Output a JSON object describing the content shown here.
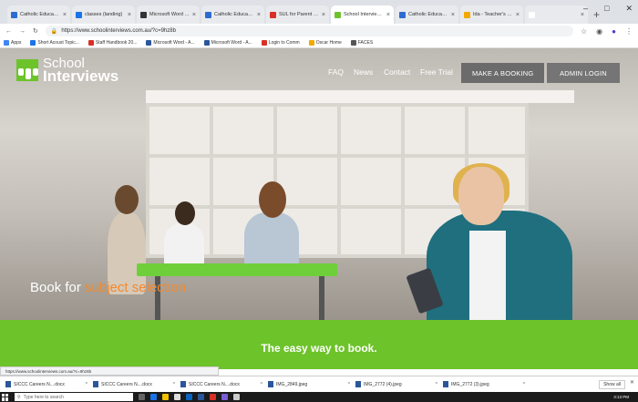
{
  "browser": {
    "tabs": [
      {
        "title": "Catholic Education",
        "color": "#2d6bd1"
      },
      {
        "title": "classes (landing)",
        "color": "#1a73e8"
      },
      {
        "title": "Microsoft Word - A",
        "color": "#333333"
      },
      {
        "title": "Catholic Education",
        "color": "#2d6bd1"
      },
      {
        "title": "SUL for Parent Teache",
        "color": "#d93025"
      },
      {
        "title": "School Interviews - S",
        "color": "#6dc32a",
        "active": true
      },
      {
        "title": "Catholic Education",
        "color": "#2d6bd1"
      },
      {
        "title": "Ida - Teacher's Timeta",
        "color": "#f2a900"
      },
      {
        "title": "",
        "color": "#ffffff"
      }
    ],
    "address": "https://www.schoolinterviews.com.au/?c=9hz8b",
    "bookmarks": [
      {
        "label": "Apps",
        "color": "#4285f4"
      },
      {
        "label": "Short Acoust Topic...",
        "color": "#1a73e8"
      },
      {
        "label": "Staff Handbook 20...",
        "color": "#d93025"
      },
      {
        "label": "Microsoft Word - A...",
        "color": "#2b579a"
      },
      {
        "label": "Microsoft Word - A...",
        "color": "#2b579a"
      },
      {
        "label": "Login to Comm",
        "color": "#d93025"
      },
      {
        "label": "Oscar Home",
        "color": "#f2a900"
      },
      {
        "label": "FACES",
        "color": "#555555"
      }
    ]
  },
  "site": {
    "logo_line1": "School",
    "logo_line2": "Interviews",
    "nav": {
      "faq": "FAQ",
      "news": "News",
      "contact": "Contact",
      "free_trial": "Free Trial",
      "booking": "MAKE A BOOKING",
      "admin": "ADMIN LOGIN"
    },
    "hero_prefix": "Book for ",
    "hero_highlight": "subject selection",
    "tagline": "The easy way to book.",
    "colors": {
      "brand_green": "#6dc32a",
      "highlight_orange": "#f28a30"
    }
  },
  "status_url": "https://www.schoolinterviews.com.au/?c=9hz8b",
  "downloads": {
    "items": [
      "SICCC Careers N....docx",
      "SICCC Careers N....docx",
      "SICCC Careers N....docx",
      "IMG_2849.jpeg",
      "IMG_2772 (4).jpeg",
      "IMG_2772 (3).jpeg"
    ],
    "show_all": "Show all"
  },
  "taskbar": {
    "search_placeholder": "Type here to search",
    "time": "3:13 PM"
  }
}
